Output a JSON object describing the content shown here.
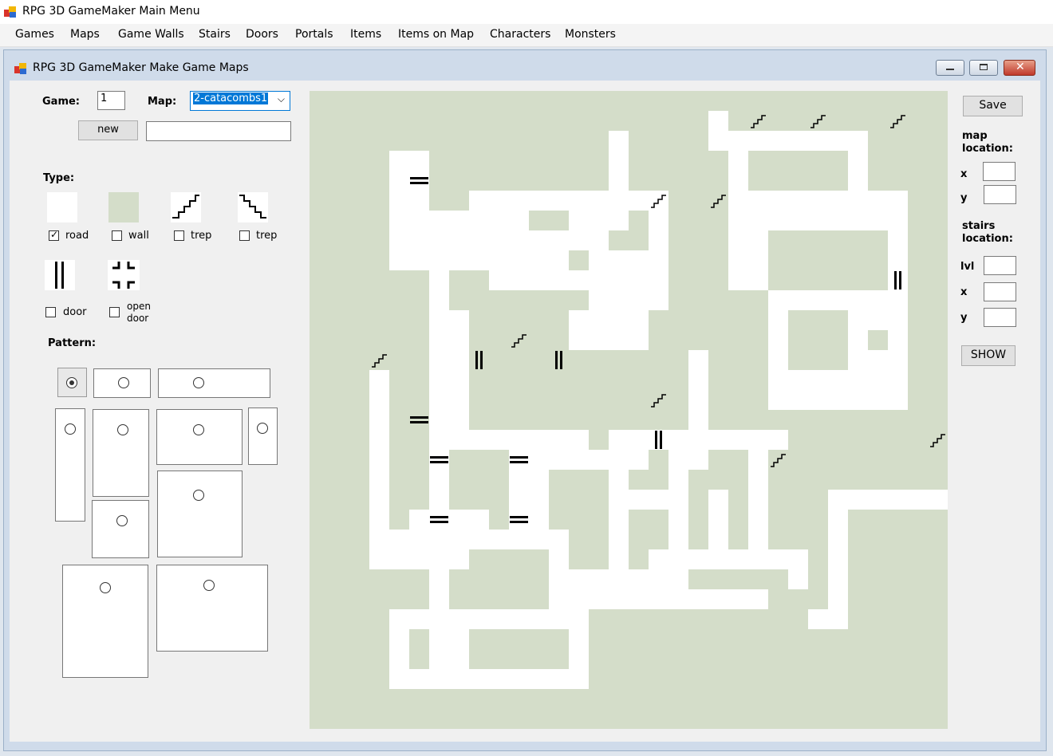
{
  "app": {
    "title": "RPG 3D GameMaker Main Menu",
    "icon": "app-icon"
  },
  "menu": [
    {
      "label": "Games"
    },
    {
      "label": "Maps"
    },
    {
      "label": "Game Walls"
    },
    {
      "label": "Stairs"
    },
    {
      "label": "Doors"
    },
    {
      "label": "Portals"
    },
    {
      "label": "Items"
    },
    {
      "label": "Items on Map"
    },
    {
      "label": "Characters"
    },
    {
      "label": "Monsters"
    }
  ],
  "child": {
    "title": "RPG 3D GameMaker Make Game Maps",
    "icon": "app-icon"
  },
  "form": {
    "game_label": "Game:",
    "game_value": "1",
    "map_label": "Map:",
    "map_value": "2-catacombs1",
    "new_label": "new",
    "new_name_value": "",
    "type_label": "Type:",
    "types": [
      {
        "label": "road",
        "checked": true,
        "icon": "road-tile-icon"
      },
      {
        "label": "wall",
        "checked": false,
        "icon": "wall-tile-icon"
      },
      {
        "label": "trep",
        "checked": false,
        "icon": "stairs-up-icon"
      },
      {
        "label": "trep",
        "checked": false,
        "icon": "stairs-down-icon"
      },
      {
        "label": "door",
        "checked": false,
        "icon": "door-icon"
      },
      {
        "label": "open\ndoor",
        "checked": false,
        "icon": "open-door-icon"
      }
    ],
    "pattern_label": "Pattern:",
    "pattern_selected": 0
  },
  "right": {
    "save_label": "Save",
    "map_location_label": "map\nlocation:",
    "x_label": "x",
    "y_label": "y",
    "x_value": "",
    "y_value": "",
    "stairs_location_label": "stairs\nlocation:",
    "lvl_label": "lvl",
    "stairs_lvl": "",
    "stairs_x": "",
    "stairs_y": "",
    "show_label": "SHOW"
  },
  "colors": {
    "road": "#ffffff",
    "wall": "#d4ddc9",
    "accent": "#0078d7"
  },
  "map_grid": {
    "size": 32,
    "road_rows": [
      "................................",
      "....................#...........",
      "...............#....########....",
      "....##.........#.....#.....#....",
      "....##.........#.....#.....#....",
      "....##..##########...#########..",
      "....#######..###.#...#########..",
      "....###########..#...##......#..",
      "....#########.####...##......#..",
      "......#..#########...##......#..",
      "......#.......####.....#######..",
      "......##.....####......#...###..",
      "......##.....####......#...#.#..",
      "......##...........#...#...###..",
      "...#..##...........#...#######..",
      "...#..##...........#...#######..",
      "...#..##...........#............",
      "...#..########.#########........",
      "...#..#...#######.##..#.........",
      "...#..#...##...#..#...#.........",
      "...#..#...##...####.#.#...##########",
      "...#.####.##...#..#.#.#...#........#",
      "...##########..#..#.#.#...#......#.",
      "...#####....#..#.########.#.......#",
      "......#.....#######.....#.#........",
      "......#.....###########...#........",
      "....##########...........##........",
      "....#.##.....#...................",
      "....#.##.....#....................",
      "....##########...................."
    ]
  }
}
